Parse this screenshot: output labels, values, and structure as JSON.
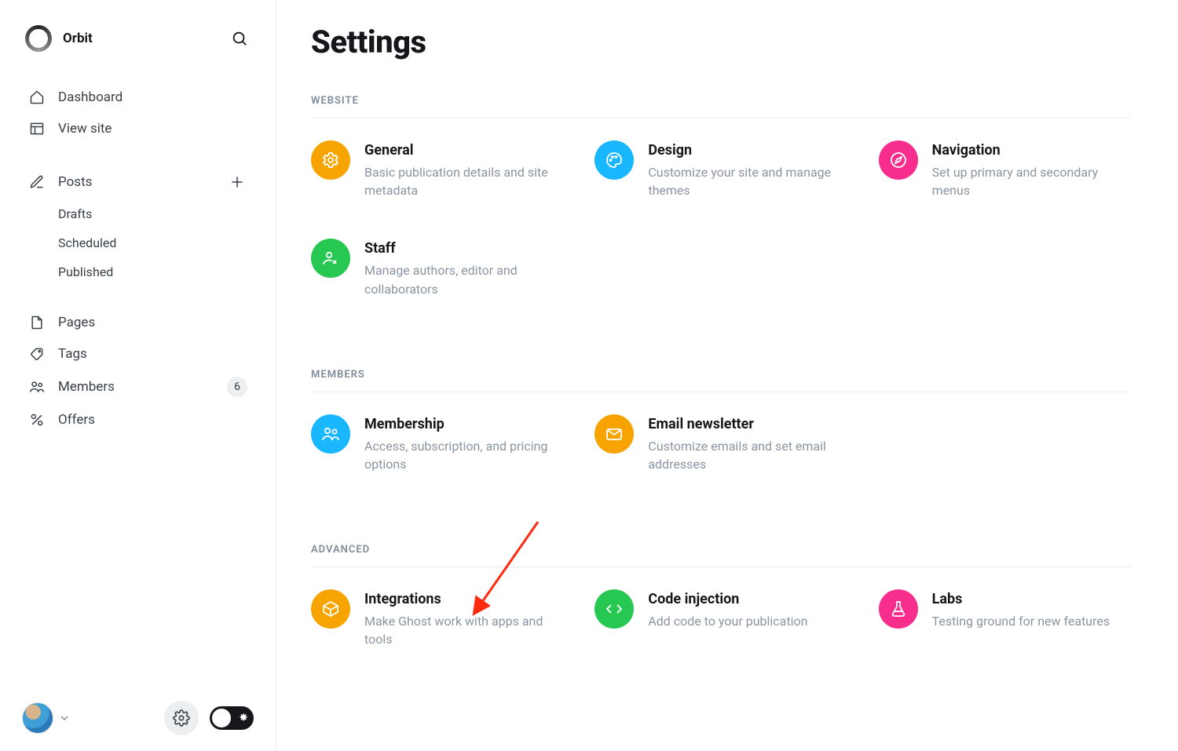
{
  "brand": {
    "name": "Orbit"
  },
  "sidebar": {
    "dashboard": "Dashboard",
    "view_site": "View site",
    "posts": "Posts",
    "drafts": "Drafts",
    "scheduled": "Scheduled",
    "published": "Published",
    "pages": "Pages",
    "tags": "Tags",
    "members": "Members",
    "members_count": "6",
    "offers": "Offers"
  },
  "page": {
    "title": "Settings"
  },
  "sections": {
    "website": {
      "header": "WEBSITE",
      "general": {
        "title": "General",
        "desc": "Basic publication details and site metadata"
      },
      "design": {
        "title": "Design",
        "desc": "Customize your site and manage themes"
      },
      "navigation": {
        "title": "Navigation",
        "desc": "Set up primary and secondary menus"
      },
      "staff": {
        "title": "Staff",
        "desc": "Manage authors, editor and collaborators"
      }
    },
    "members": {
      "header": "MEMBERS",
      "membership": {
        "title": "Membership",
        "desc": "Access, subscription, and pricing options"
      },
      "email": {
        "title": "Email newsletter",
        "desc": "Customize emails and set email addresses"
      }
    },
    "advanced": {
      "header": "ADVANCED",
      "integrations": {
        "title": "Integrations",
        "desc": "Make Ghost work with apps and tools"
      },
      "code_injection": {
        "title": "Code injection",
        "desc": "Add code to your publication"
      },
      "labs": {
        "title": "Labs",
        "desc": "Testing ground for new features"
      }
    }
  }
}
